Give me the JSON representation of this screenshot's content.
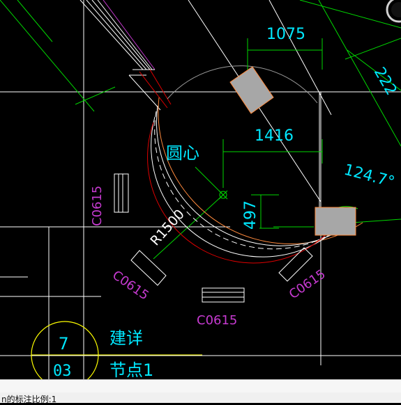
{
  "colors": {
    "background": "#000000",
    "aux_lines": "#ffffff",
    "green": "#00d800",
    "dim_cyan": "#00e8ff",
    "red": "#e00000",
    "orange": "#ff8a3d",
    "magenta": "#c63ad0",
    "yellow": "#ffff00",
    "gray_box": "#a7a7a7"
  },
  "dimensions": {
    "d1075": "1075",
    "d1416": "1416",
    "d497": "497",
    "d2227": "222",
    "angle": "124.7°",
    "radius": "R1500"
  },
  "labels": {
    "center": "圆心",
    "c0615_left": "C0615",
    "c0615_bottom_left": "C0615",
    "c0615_bottom": "C0615",
    "c0615_bottom_right": "C0615",
    "detail_top": "建详",
    "detail_bottom": "节点1"
  },
  "detail_marker": {
    "number": "7",
    "sheet": "03"
  },
  "status_bar": {
    "text": "n的标注比例:1"
  }
}
